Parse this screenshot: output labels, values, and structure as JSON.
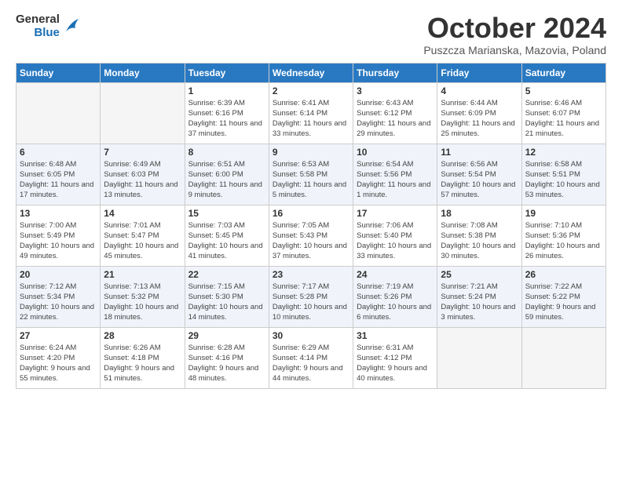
{
  "header": {
    "logo_line1": "General",
    "logo_line2": "Blue",
    "title": "October 2024",
    "subtitle": "Puszcza Marianska, Mazovia, Poland"
  },
  "days_of_week": [
    "Sunday",
    "Monday",
    "Tuesday",
    "Wednesday",
    "Thursday",
    "Friday",
    "Saturday"
  ],
  "weeks": [
    [
      {
        "day": "",
        "info": ""
      },
      {
        "day": "",
        "info": ""
      },
      {
        "day": "1",
        "info": "Sunrise: 6:39 AM\nSunset: 6:16 PM\nDaylight: 11 hours and 37 minutes."
      },
      {
        "day": "2",
        "info": "Sunrise: 6:41 AM\nSunset: 6:14 PM\nDaylight: 11 hours and 33 minutes."
      },
      {
        "day": "3",
        "info": "Sunrise: 6:43 AM\nSunset: 6:12 PM\nDaylight: 11 hours and 29 minutes."
      },
      {
        "day": "4",
        "info": "Sunrise: 6:44 AM\nSunset: 6:09 PM\nDaylight: 11 hours and 25 minutes."
      },
      {
        "day": "5",
        "info": "Sunrise: 6:46 AM\nSunset: 6:07 PM\nDaylight: 11 hours and 21 minutes."
      }
    ],
    [
      {
        "day": "6",
        "info": "Sunrise: 6:48 AM\nSunset: 6:05 PM\nDaylight: 11 hours and 17 minutes."
      },
      {
        "day": "7",
        "info": "Sunrise: 6:49 AM\nSunset: 6:03 PM\nDaylight: 11 hours and 13 minutes."
      },
      {
        "day": "8",
        "info": "Sunrise: 6:51 AM\nSunset: 6:00 PM\nDaylight: 11 hours and 9 minutes."
      },
      {
        "day": "9",
        "info": "Sunrise: 6:53 AM\nSunset: 5:58 PM\nDaylight: 11 hours and 5 minutes."
      },
      {
        "day": "10",
        "info": "Sunrise: 6:54 AM\nSunset: 5:56 PM\nDaylight: 11 hours and 1 minute."
      },
      {
        "day": "11",
        "info": "Sunrise: 6:56 AM\nSunset: 5:54 PM\nDaylight: 10 hours and 57 minutes."
      },
      {
        "day": "12",
        "info": "Sunrise: 6:58 AM\nSunset: 5:51 PM\nDaylight: 10 hours and 53 minutes."
      }
    ],
    [
      {
        "day": "13",
        "info": "Sunrise: 7:00 AM\nSunset: 5:49 PM\nDaylight: 10 hours and 49 minutes."
      },
      {
        "day": "14",
        "info": "Sunrise: 7:01 AM\nSunset: 5:47 PM\nDaylight: 10 hours and 45 minutes."
      },
      {
        "day": "15",
        "info": "Sunrise: 7:03 AM\nSunset: 5:45 PM\nDaylight: 10 hours and 41 minutes."
      },
      {
        "day": "16",
        "info": "Sunrise: 7:05 AM\nSunset: 5:43 PM\nDaylight: 10 hours and 37 minutes."
      },
      {
        "day": "17",
        "info": "Sunrise: 7:06 AM\nSunset: 5:40 PM\nDaylight: 10 hours and 33 minutes."
      },
      {
        "day": "18",
        "info": "Sunrise: 7:08 AM\nSunset: 5:38 PM\nDaylight: 10 hours and 30 minutes."
      },
      {
        "day": "19",
        "info": "Sunrise: 7:10 AM\nSunset: 5:36 PM\nDaylight: 10 hours and 26 minutes."
      }
    ],
    [
      {
        "day": "20",
        "info": "Sunrise: 7:12 AM\nSunset: 5:34 PM\nDaylight: 10 hours and 22 minutes."
      },
      {
        "day": "21",
        "info": "Sunrise: 7:13 AM\nSunset: 5:32 PM\nDaylight: 10 hours and 18 minutes."
      },
      {
        "day": "22",
        "info": "Sunrise: 7:15 AM\nSunset: 5:30 PM\nDaylight: 10 hours and 14 minutes."
      },
      {
        "day": "23",
        "info": "Sunrise: 7:17 AM\nSunset: 5:28 PM\nDaylight: 10 hours and 10 minutes."
      },
      {
        "day": "24",
        "info": "Sunrise: 7:19 AM\nSunset: 5:26 PM\nDaylight: 10 hours and 6 minutes."
      },
      {
        "day": "25",
        "info": "Sunrise: 7:21 AM\nSunset: 5:24 PM\nDaylight: 10 hours and 3 minutes."
      },
      {
        "day": "26",
        "info": "Sunrise: 7:22 AM\nSunset: 5:22 PM\nDaylight: 9 hours and 59 minutes."
      }
    ],
    [
      {
        "day": "27",
        "info": "Sunrise: 6:24 AM\nSunset: 4:20 PM\nDaylight: 9 hours and 55 minutes."
      },
      {
        "day": "28",
        "info": "Sunrise: 6:26 AM\nSunset: 4:18 PM\nDaylight: 9 hours and 51 minutes."
      },
      {
        "day": "29",
        "info": "Sunrise: 6:28 AM\nSunset: 4:16 PM\nDaylight: 9 hours and 48 minutes."
      },
      {
        "day": "30",
        "info": "Sunrise: 6:29 AM\nSunset: 4:14 PM\nDaylight: 9 hours and 44 minutes."
      },
      {
        "day": "31",
        "info": "Sunrise: 6:31 AM\nSunset: 4:12 PM\nDaylight: 9 hours and 40 minutes."
      },
      {
        "day": "",
        "info": ""
      },
      {
        "day": "",
        "info": ""
      }
    ]
  ]
}
